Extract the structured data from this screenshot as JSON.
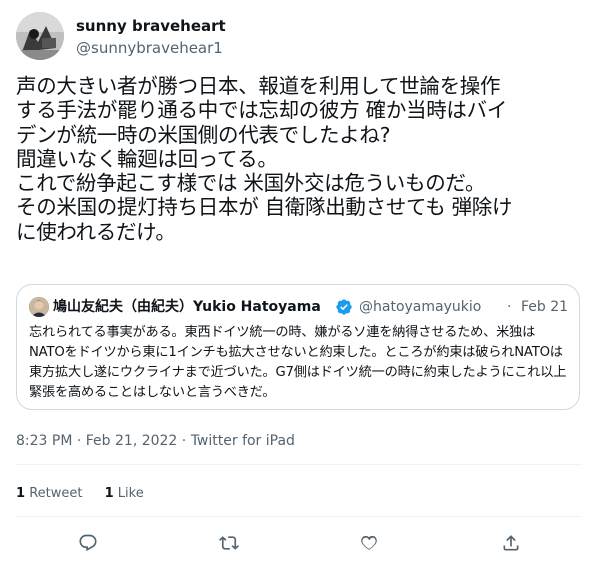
{
  "author": {
    "display_name": "sunny braveheart",
    "handle": "@sunnybravehear1",
    "avatar_icon": "avatar-photo"
  },
  "tweet": {
    "text": "声の大きい者が勝つ日本、報道を利用して世論を操作\nする手法が罷り通る中では忘却の彼方 確か当時はバイ\nデンが統一時の米国側の代表でしたよね?\n間違いなく輪廻は回ってる。\nこれで紛争起こす様では 米国外交は危ういものだ。\nその米国の提灯持ち日本が 自衛隊出動させても 弾除け\nに使われるだけ。"
  },
  "quoted": {
    "name": "鳩山友紀夫（由紀夫）Yukio Hatoyama",
    "handle": "@hatoyamayukio",
    "separator": "·",
    "date": "Feb 21",
    "text": "忘れられてる事実がある。東西ドイツ統一の時、嫌がるソ連を納得させるため、米独はNATOをドイツから東に1インチも拡大させないと約束した。ところが約束は破られNATOは東方拡大し遂にウクライナまで近づいた。G7側はドイツ統一の時に約束したようにこれ以上緊張を高めることはしないと言うべきだ。",
    "verified_icon": "verified-badge-icon",
    "accent_color": "#1d9bf0"
  },
  "meta": {
    "timestamp": "8:23 PM · Feb 21, 2022 · Twitter for iPad"
  },
  "stats": {
    "retweets_count": "1",
    "retweets_label": "Retweet",
    "likes_count": "1",
    "likes_label": "Like"
  },
  "actions": {
    "reply_icon": "reply-icon",
    "retweet_icon": "retweet-icon",
    "like_icon": "like-icon",
    "share_icon": "share-icon"
  }
}
